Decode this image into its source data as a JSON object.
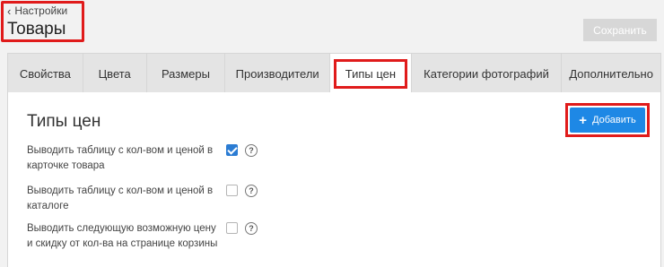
{
  "header": {
    "back_label": "Настройки",
    "title": "Товары",
    "save_label": "Сохранить"
  },
  "tabs": [
    {
      "label": "Свойства",
      "active": false
    },
    {
      "label": "Цвета",
      "active": false
    },
    {
      "label": "Размеры",
      "active": false
    },
    {
      "label": "Производители",
      "active": false
    },
    {
      "label": "Типы цен",
      "active": true
    },
    {
      "label": "Категории фотографий",
      "active": false
    },
    {
      "label": "Дополнительно",
      "active": false
    }
  ],
  "section": {
    "title": "Типы цен",
    "add_label": "Добавить"
  },
  "options": [
    {
      "label": "Выводить таблицу с кол-вом и ценой в карточке товара",
      "checked": true
    },
    {
      "label": "Выводить таблицу с кол-вом и ценой в каталоге",
      "checked": false
    },
    {
      "label": "Выводить следующую возможную цену и скидку от кол-ва на странице корзины",
      "checked": false
    }
  ],
  "help_glyph": "?",
  "colors": {
    "highlight": "#e01b1b",
    "primary_button": "#1e88e5",
    "checkbox_checked": "#2b7cd3"
  }
}
